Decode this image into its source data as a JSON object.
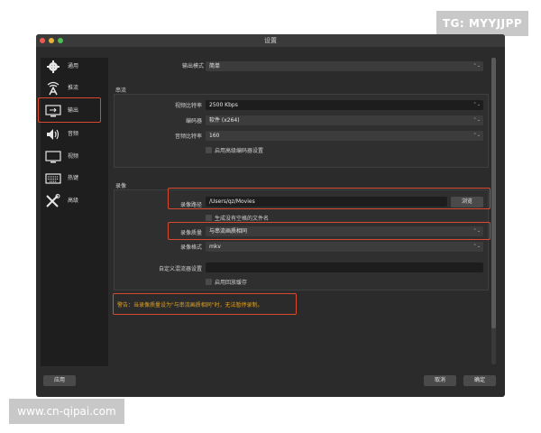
{
  "overlays": {
    "tg": "TG: MYYJJPP",
    "www": "www.cn-qipai.com"
  },
  "window": {
    "title": "设置"
  },
  "sidebar": {
    "items": [
      {
        "label": "通用",
        "icon": "gear-icon"
      },
      {
        "label": "推流",
        "icon": "broadcast-icon"
      },
      {
        "label": "输出",
        "icon": "output-monitor-icon"
      },
      {
        "label": "音频",
        "icon": "speaker-icon"
      },
      {
        "label": "视频",
        "icon": "display-icon"
      },
      {
        "label": "热键",
        "icon": "keyboard-icon"
      },
      {
        "label": "高级",
        "icon": "tools-icon"
      }
    ],
    "selected": "输出"
  },
  "output_mode": {
    "label": "输出模式",
    "value": "简单"
  },
  "streaming": {
    "title": "串流",
    "video_bitrate": {
      "label": "视频比特率",
      "value": "2500 Kbps"
    },
    "encoder": {
      "label": "编码器",
      "value": "软件 (x264)"
    },
    "audio_bitrate": {
      "label": "音频比特率",
      "value": "160"
    },
    "advanced_encoder_checkbox": "启用高级编码器设置"
  },
  "recording": {
    "title": "录像",
    "path": {
      "label": "录像路径",
      "value": "/Users/qz/Movies",
      "browse": "浏览"
    },
    "no_space_checkbox": "生成没有空格的文件名",
    "quality": {
      "label": "录像质量",
      "value": "与串流画质相同"
    },
    "format": {
      "label": "录像格式",
      "value": "mkv"
    },
    "muxer": {
      "label": "自定义混流器设置",
      "value": ""
    },
    "replay_buffer_checkbox": "启用回放缓存"
  },
  "warning": "警告：当录像质量设为\"与串流画质相同\"时，无法暂停录制。",
  "buttons": {
    "apply": "应用",
    "cancel": "取消",
    "ok": "确定"
  },
  "colors": {
    "highlight": "#d84a30",
    "warning": "#e0a020",
    "accent": "#3b7ad8"
  }
}
